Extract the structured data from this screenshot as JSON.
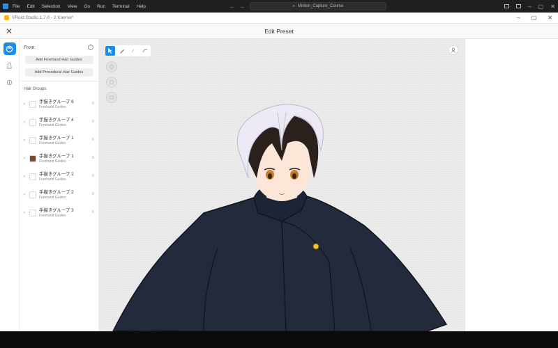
{
  "os": {
    "menu": [
      "File",
      "Edit",
      "Selection",
      "View",
      "Go",
      "Run",
      "Terminal",
      "Help"
    ],
    "search_text": "Motion_Capture_Course"
  },
  "app": {
    "window_title": "VRoid Studio 1.7.0 - 2.Kaenai*",
    "header_title": "Edit Preset"
  },
  "panel": {
    "section_title": "Front",
    "add_freehand": "Add Freehand Hair Guides",
    "add_procedural": "Add Procedural Hair Guides",
    "hair_groups_label": "Hair Groups",
    "groups": [
      {
        "name": "手描きグループ 6",
        "sub": "Freehand Guides",
        "color": "#ffffff"
      },
      {
        "name": "手描きグループ 4",
        "sub": "Freehand Guides",
        "color": "#ffffff"
      },
      {
        "name": "手描きグループ 1",
        "sub": "Freehand Guides",
        "color": "#ffffff"
      },
      {
        "name": "手描きグループ 1",
        "sub": "Freehand Guides",
        "color": "#7a4a2e"
      },
      {
        "name": "手描きグループ 2",
        "sub": "Freehand Guides",
        "color": "#ffffff"
      },
      {
        "name": "手描きグループ 2",
        "sub": "Freehand Guides",
        "color": "#ffffff"
      },
      {
        "name": "手描きグループ 3",
        "sub": "Freehand Guides",
        "color": "#ffffff"
      }
    ]
  },
  "colors": {
    "accent": "#1a8dea",
    "coat": "#222a3c",
    "hair_dark": "#2a211d",
    "hair_light": "#ece9f4"
  },
  "icons": {
    "os_logo": "vscode-icon",
    "rail": [
      "hair-icon",
      "body-icon",
      "accessory-icon"
    ],
    "tools": [
      "select-cursor-icon",
      "pen-icon",
      "eraser-icon",
      "smooth-icon"
    ],
    "camera": "camera-reset-icon"
  }
}
